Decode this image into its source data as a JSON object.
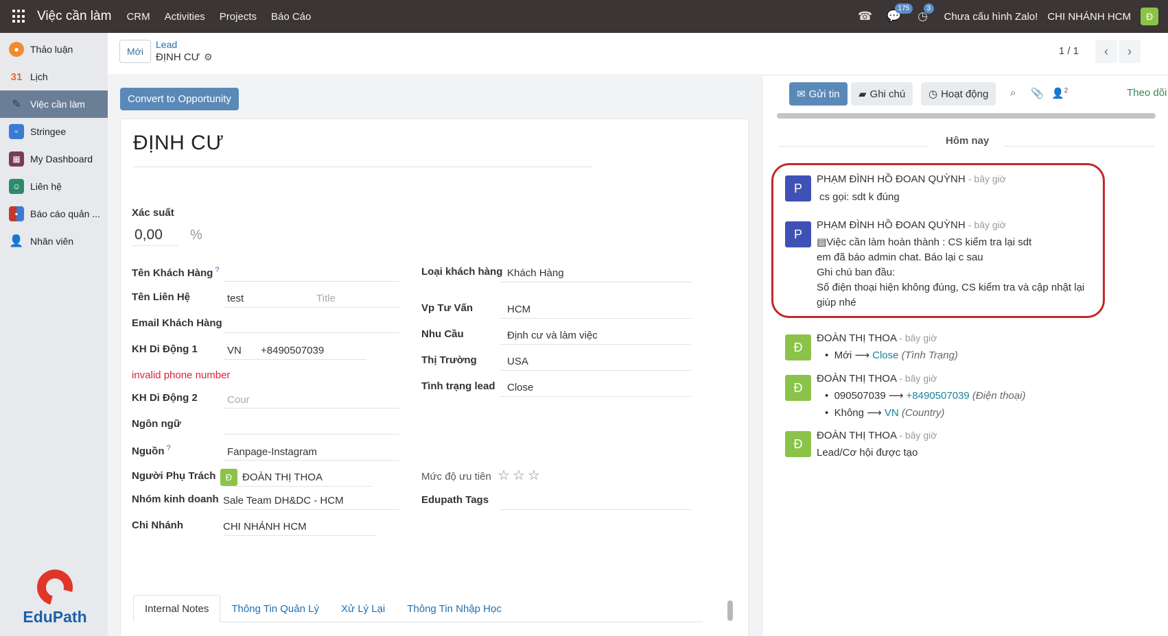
{
  "topbar": {
    "brand": "Việc cần làm",
    "nav": [
      "CRM",
      "Activities",
      "Projects",
      "Báo Cáo"
    ],
    "chat_badge": "175",
    "activity_badge": "3",
    "zalo_status": "Chưa cấu hình Zalo!",
    "branch": "CHI NHÁNH HCM",
    "avatar_letter": "Đ"
  },
  "sidebar": {
    "items": [
      {
        "label": "Thảo luận",
        "color": "#f08c2e"
      },
      {
        "label": "Lịch",
        "color": "#e06c2c"
      },
      {
        "label": "Việc cần làm",
        "color": "#2f5f8c"
      },
      {
        "label": "Stringee",
        "color": "#3a7bd5"
      },
      {
        "label": "My Dashboard",
        "color": "#7a3b5a"
      },
      {
        "label": "Liên hệ",
        "color": "#2c8c6a"
      },
      {
        "label": "Báo cáo quản ...",
        "color": "#c0392b"
      },
      {
        "label": "Nhân viên",
        "color": "#8e6fb5"
      }
    ],
    "logo_text": "EduPath"
  },
  "breadcrumb": {
    "new_button": "Mới",
    "parent": "Lead",
    "current": "ĐỊNH CƯ",
    "pager": "1 / 1"
  },
  "form": {
    "convert_button": "Convert to Opportunity",
    "title": "ĐỊNH CƯ",
    "probability_label": "Xác suất",
    "probability_value": "0,00",
    "probability_unit": "%",
    "left_fields": {
      "customer_name_label": "Tên Khách Hàng",
      "contact_name_label": "Tên Liên Hệ",
      "contact_name_value": "test",
      "contact_title_placeholder": "Title",
      "email_label": "Email Khách Hàng",
      "mobile1_label": "KH Di Động 1",
      "mobile1_country": "VN",
      "mobile1_value": "+8490507039",
      "invalid_phone": "invalid phone number",
      "mobile2_label": "KH Di Động 2",
      "mobile2_placeholder": "Cour",
      "language_label": "Ngôn ngữ",
      "source_label": "Nguồn",
      "source_value": "Fanpage-Instagram",
      "owner_label": "Người Phụ Trách",
      "owner_avatar": "Đ",
      "owner_value": "ĐOÀN THỊ THOA",
      "team_label": "Nhóm kinh doanh",
      "team_value": "Sale Team DH&DC - HCM",
      "branch_label": "Chi Nhánh",
      "branch_value": "CHI NHÁNH HCM"
    },
    "right_fields": {
      "customer_type_label": "Loại khách hàng",
      "customer_type_value": "Khách Hàng",
      "office_label": "Vp Tư Vấn",
      "office_value": "HCM",
      "need_label": "Nhu Cầu",
      "need_value": "Định cư và làm việc",
      "market_label": "Thị Trường",
      "market_value": "USA",
      "status_label": "Tình trạng lead",
      "status_value": "Close",
      "priority_label": "Mức độ ưu tiên",
      "priority_stars": 0,
      "tags_label": "Edupath Tags"
    },
    "tabs": [
      "Internal Notes",
      "Thông Tin Quản Lý",
      "Xử Lý Lại",
      "Thông Tin Nhập Học"
    ]
  },
  "chatter": {
    "send_button": "Gửi tin",
    "note_button": "Ghi chú",
    "activity_button": "Hoạt động",
    "followers_count": "2",
    "follow": "Theo dõi",
    "today": "Hôm nay",
    "messages": [
      {
        "avatar": "P",
        "author": "PHẠM ĐÌNH HỒ ĐOAN QUỲNH",
        "time": "- bây giờ",
        "text": "cs gọi: sdt k đúng"
      },
      {
        "avatar": "P",
        "author": "PHẠM ĐÌNH HỒ ĐOAN QUỲNH",
        "time": "- bây giờ",
        "line1": "Việc cần làm hoàn thành : CS kiểm tra lại sdt",
        "line2": "em đã báo admin chat. Báo lại c sau",
        "line3": "Ghi chú ban đầu:",
        "line4": "Số điện thoại hiện không đúng, CS kiểm tra và cập nhật lại",
        "line5": "giúp nhé"
      },
      {
        "avatar": "Đ",
        "author": "ĐOÀN THỊ THOA",
        "time": "- bây giờ",
        "change_from": "Mới",
        "change_to": "Close",
        "change_field": "(Tình Trạng)"
      },
      {
        "avatar": "Đ",
        "author": "ĐOÀN THỊ THOA",
        "time": "- bây giờ",
        "change1_from": "090507039",
        "change1_to": "+8490507039",
        "change1_field": "(Điện thoại)",
        "change2_from": "Không",
        "change2_to": "VN",
        "change2_field": "(Country)"
      },
      {
        "avatar": "Đ",
        "author": "ĐOÀN THỊ THOA",
        "time": "- bây giờ",
        "text": "Lead/Cơ hội được tạo"
      }
    ]
  },
  "colors": {
    "topbar": "#3b3535",
    "primary": "#5a89b8",
    "avatar_p": "#3f51b5",
    "avatar_d": "#8bc34a",
    "highlight": "#c4282a"
  }
}
